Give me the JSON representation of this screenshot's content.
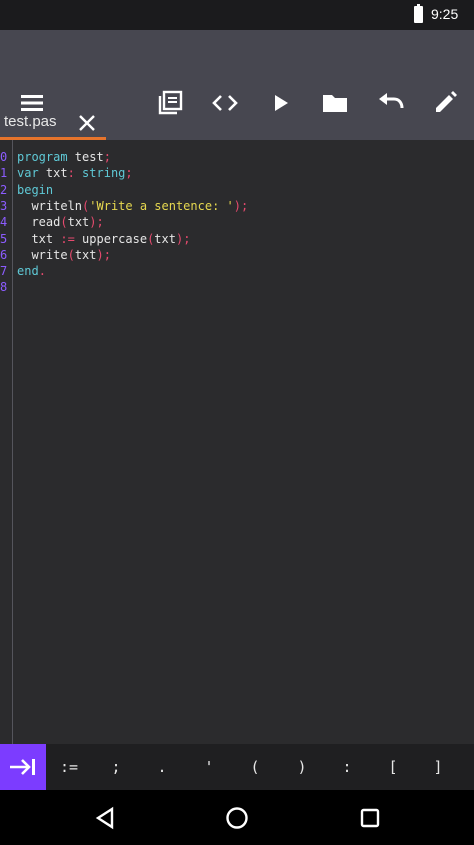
{
  "status_bar": {
    "time": "9:25"
  },
  "toolbar": {
    "icons": [
      "menu-icon",
      "library-icon",
      "code-icon",
      "run-icon",
      "folder-icon",
      "undo-icon",
      "edit-icon"
    ]
  },
  "tabs": [
    {
      "label": "test.pas"
    }
  ],
  "editor": {
    "line_numbers": [
      "0",
      "1",
      "2",
      "3",
      "4",
      "5",
      "6",
      "7",
      "8"
    ],
    "lines": [
      [
        {
          "t": "program",
          "c": "kw"
        },
        {
          "t": " test",
          "c": "plain"
        },
        {
          "t": ";",
          "c": "punc"
        }
      ],
      [
        {
          "t": "var",
          "c": "kw"
        },
        {
          "t": " txt",
          "c": "plain"
        },
        {
          "t": ":",
          "c": "punc"
        },
        {
          "t": " string",
          "c": "kw"
        },
        {
          "t": ";",
          "c": "punc"
        }
      ],
      [
        {
          "t": "begin",
          "c": "kw"
        }
      ],
      [
        {
          "t": "  writeln",
          "c": "plain"
        },
        {
          "t": "(",
          "c": "punc"
        },
        {
          "t": "'Write a sentence: '",
          "c": "str"
        },
        {
          "t": ");",
          "c": "punc"
        }
      ],
      [
        {
          "t": "  read",
          "c": "plain"
        },
        {
          "t": "(",
          "c": "punc"
        },
        {
          "t": "txt",
          "c": "plain"
        },
        {
          "t": ");",
          "c": "punc"
        }
      ],
      [
        {
          "t": "  txt ",
          "c": "plain"
        },
        {
          "t": ":=",
          "c": "punc"
        },
        {
          "t": " uppercase",
          "c": "plain"
        },
        {
          "t": "(",
          "c": "punc"
        },
        {
          "t": "txt",
          "c": "plain"
        },
        {
          "t": ");",
          "c": "punc"
        }
      ],
      [
        {
          "t": "  write",
          "c": "plain"
        },
        {
          "t": "(",
          "c": "punc"
        },
        {
          "t": "txt",
          "c": "plain"
        },
        {
          "t": ");",
          "c": "punc"
        }
      ],
      [
        {
          "t": "end",
          "c": "kw"
        },
        {
          "t": ".",
          "c": "punc"
        }
      ],
      []
    ]
  },
  "keybar": {
    "tab_key_icon": "tab-arrow-icon",
    "symbols": [
      ":=",
      ";",
      ".",
      "'",
      "(",
      ")",
      ":",
      "[",
      "]"
    ]
  },
  "navbar": {
    "icons": [
      "back-icon",
      "home-icon",
      "recents-icon"
    ]
  },
  "colors": {
    "toolbar": "#474750",
    "editor_bg": "#2b2b2d",
    "tab_underline": "#e6742c",
    "accent": "#7c3cff",
    "keyword": "#5fc9d6",
    "string": "#e6d84f",
    "punctuation": "#e64a6e"
  }
}
